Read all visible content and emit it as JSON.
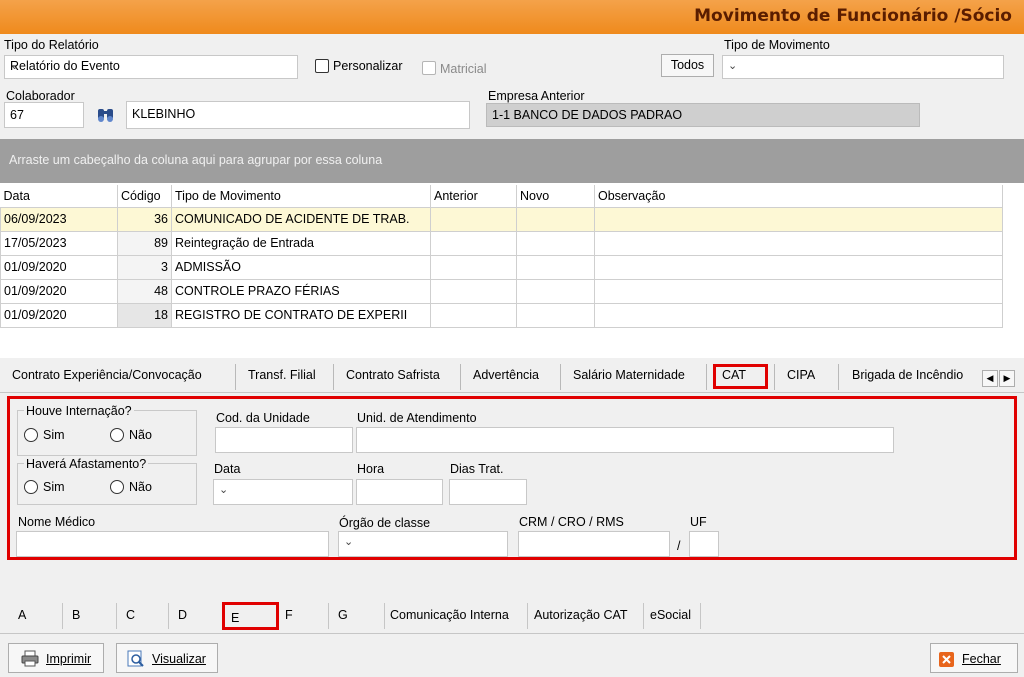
{
  "window": {
    "title": "Movimento de Funcionário /Sócio"
  },
  "report": {
    "type_label": "Tipo do Relatório",
    "type_value": "Relatório do Evento",
    "personalizar": "Personalizar",
    "matricial": "Matricial",
    "todos": "Todos",
    "movement_type_label": "Tipo de Movimento",
    "movement_type_value": ""
  },
  "collaborator": {
    "label": "Colaborador",
    "code": "67",
    "name": "KLEBINHO",
    "prev_company_label": "Empresa Anterior",
    "prev_company": "1-1  BANCO DE DADOS PADRAO"
  },
  "grid": {
    "group_hint": "Arraste um cabeçalho da coluna aqui para agrupar por essa coluna",
    "columns": [
      "Data",
      "Código",
      "Tipo de Movimento",
      "Anterior",
      "Novo",
      "Observação"
    ],
    "rows": [
      {
        "date": "06/09/2023",
        "code": "36",
        "type": "COMUNICADO DE ACIDENTE DE TRAB.",
        "prev": "",
        "new": "",
        "obs": ""
      },
      {
        "date": "17/05/2023",
        "code": "89",
        "type": "Reintegração de Entrada",
        "prev": "",
        "new": "",
        "obs": ""
      },
      {
        "date": "01/09/2020",
        "code": "3",
        "type": "ADMISSÃO",
        "prev": "",
        "new": "",
        "obs": ""
      },
      {
        "date": "01/09/2020",
        "code": "48",
        "type": "CONTROLE PRAZO FÉRIAS",
        "prev": "",
        "new": "",
        "obs": ""
      },
      {
        "date": "01/09/2020",
        "code": "18",
        "type": "REGISTRO DE CONTRATO DE EXPERII",
        "prev": "",
        "new": "",
        "obs": ""
      }
    ]
  },
  "tabs": [
    "Contrato Experiência/Convocação",
    "Transf. Filial",
    "Contrato Safrista",
    "Advertência",
    "Salário Maternidade",
    "CAT",
    "CIPA",
    "Brigada de Incêndio"
  ],
  "cat": {
    "internacao_label": "Houve Internação?",
    "afastamento_label": "Haverá Afastamento?",
    "sim": "Sim",
    "nao": "Não",
    "cod_unidade": "Cod. da Unidade",
    "unid_atendimento": "Unid. de Atendimento",
    "data": "Data",
    "hora": "Hora",
    "dias_trat": "Dias Trat.",
    "nome_medico": "Nome Médico",
    "orgao_classe": "Órgão de classe",
    "crm": "CRM / CRO / RMS",
    "uf": "UF",
    "slash": "/"
  },
  "bottom_tabs": [
    "A",
    "B",
    "C",
    "D",
    "E",
    "F",
    "G",
    "Comunicação Interna",
    "Autorização CAT",
    "eSocial"
  ],
  "footer": {
    "print": "Imprimir",
    "preview": "Visualizar",
    "close": "Fechar"
  }
}
